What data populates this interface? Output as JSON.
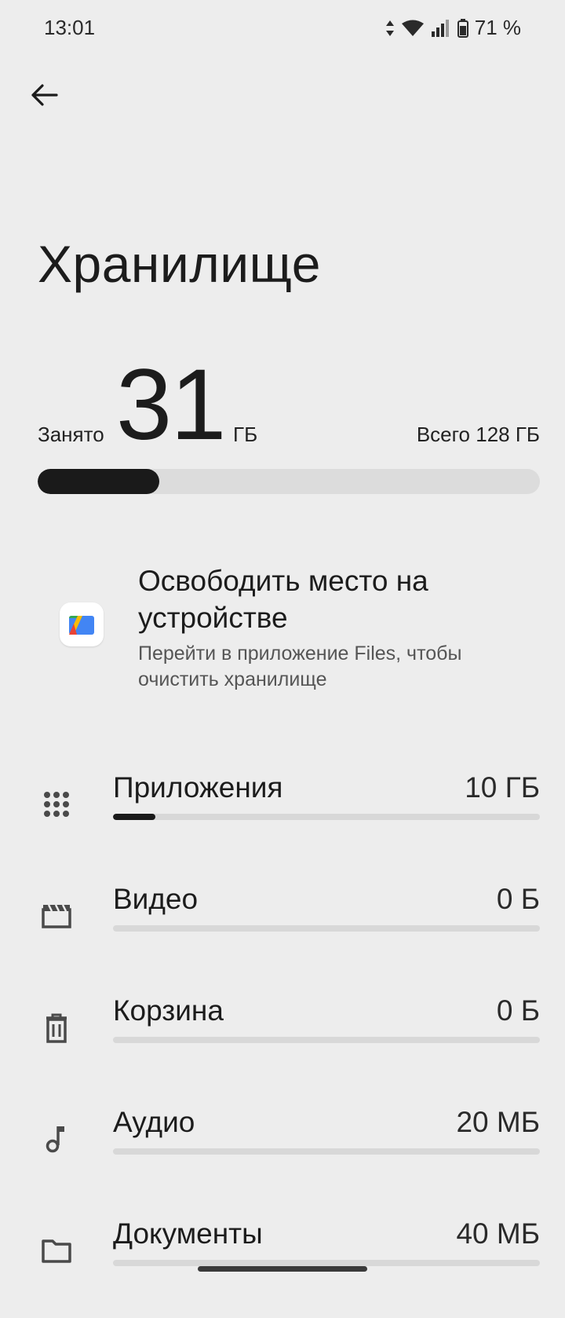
{
  "status_bar": {
    "time": "13:01",
    "battery_percent": "71 %",
    "icons": [
      "data-arrows-icon",
      "wifi-icon",
      "signal-icon",
      "battery-icon"
    ]
  },
  "header": {
    "back_icon": "arrow-left-icon",
    "title": "Хранилище"
  },
  "summary": {
    "used_label": "Занято",
    "used_value": "31",
    "used_unit": "ГБ",
    "total_label": "Всего 128 ГБ",
    "used_fraction": 0.242
  },
  "free_up": {
    "icon": "files-app-icon",
    "title": "Освободить место на устройстве",
    "subtitle": "Перейти в приложение Files, чтобы очистить хранилище"
  },
  "categories": [
    {
      "label": "Приложения",
      "value": "10 ГБ",
      "icon": "apps-grid-icon",
      "fraction": 0.1
    },
    {
      "label": "Видео",
      "value": "0 Б",
      "icon": "video-clapper-icon",
      "fraction": 0
    },
    {
      "label": "Корзина",
      "value": "0 Б",
      "icon": "trash-icon",
      "fraction": 0
    },
    {
      "label": "Аудио",
      "value": "20 МБ",
      "icon": "music-note-icon",
      "fraction": 0
    },
    {
      "label": "Документы",
      "value": "40 МБ",
      "icon": "folder-icon",
      "fraction": 0
    }
  ],
  "colors": {
    "background": "#ededed",
    "bar_fill": "#1a1a1a",
    "bar_track": "#dcdcdc"
  }
}
